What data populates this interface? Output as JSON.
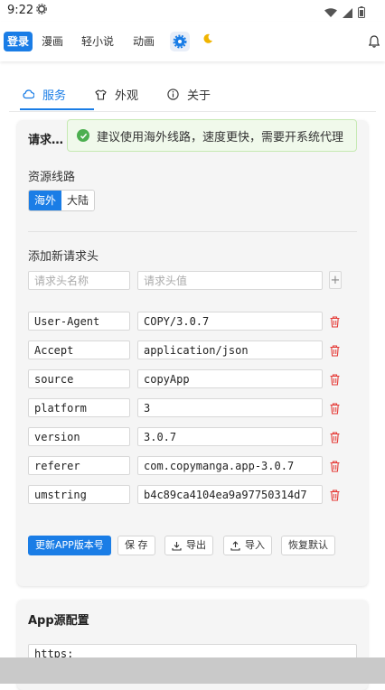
{
  "status": {
    "time": "9:22"
  },
  "nav": {
    "login": "登录",
    "items": [
      "漫画",
      "轻小说",
      "动画"
    ]
  },
  "tabs": [
    {
      "label": "服务",
      "icon": "cloud-icon"
    },
    {
      "label": "外观",
      "icon": "shirt-icon"
    },
    {
      "label": "关于",
      "icon": "info-icon"
    }
  ],
  "card": {
    "title": "请求…",
    "source_line_label": "资源线路",
    "segments": [
      "海外",
      "大陆"
    ],
    "add_header_label": "添加新请求头",
    "key_placeholder": "请求头名称",
    "value_placeholder": "请求头值",
    "headers": [
      {
        "key": "User-Agent",
        "value": "COPY/3.0.7"
      },
      {
        "key": "Accept",
        "value": "application/json"
      },
      {
        "key": "source",
        "value": "copyApp"
      },
      {
        "key": "platform",
        "value": "3"
      },
      {
        "key": "version",
        "value": "3.0.7"
      },
      {
        "key": "referer",
        "value": "com.copymanga.app-3.0.7"
      },
      {
        "key": "umstring",
        "value": "b4c89ca4104ea9a97750314d7"
      }
    ],
    "buttons": {
      "update": "更新APP版本号",
      "save": "保 存",
      "export": "导出",
      "import": "导入",
      "reset": "恢复默认"
    }
  },
  "toast": {
    "message": "建议使用海外线路，速度更快，需要开系统代理"
  },
  "card2": {
    "title": "App源配置",
    "url_partial": "https:"
  },
  "colors": {
    "accent": "#1a7de6",
    "danger": "#e53935",
    "success": "#4caf50"
  }
}
